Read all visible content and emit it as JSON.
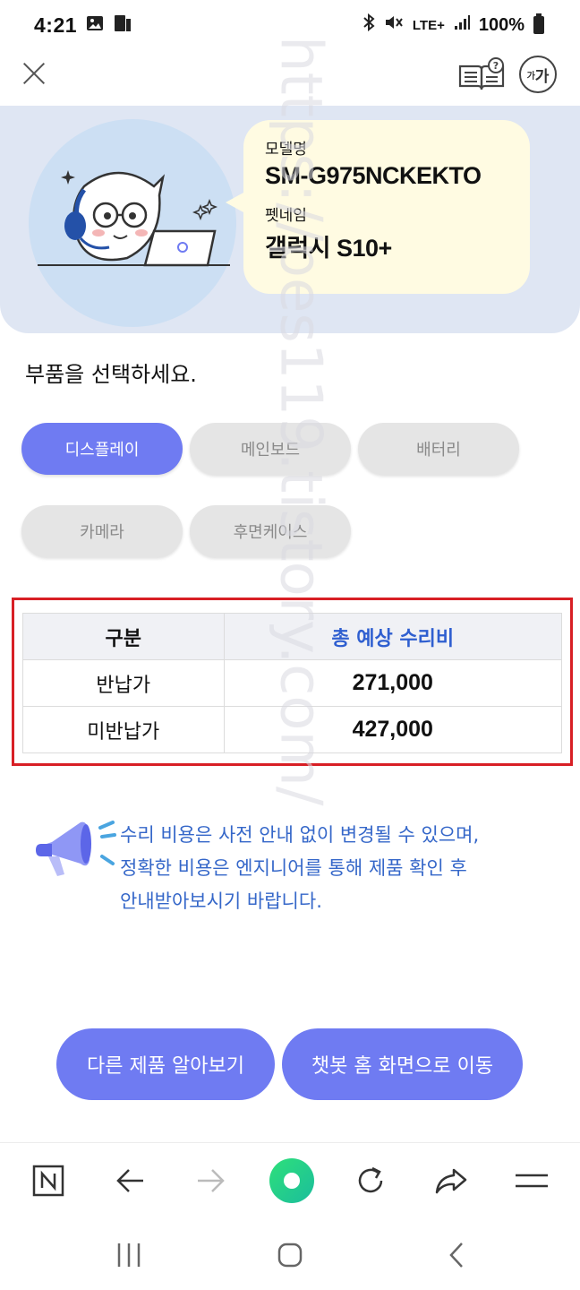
{
  "status_bar": {
    "time": "4:21",
    "network": "LTE+",
    "battery": "100%",
    "icons": [
      "gallery-icon",
      "sim-icon",
      "bluetooth-icon",
      "mute-icon",
      "signal-icon",
      "battery-icon"
    ]
  },
  "toolbar": {
    "close_icon": "close-icon",
    "guide_icon": "book-help-icon",
    "font_size_icon": "font-size-icon",
    "font_size_label_small": "가",
    "font_size_label_large": "가"
  },
  "device": {
    "model_label": "모델명",
    "model_value": "SM-G975NCKEKTO",
    "pet_name_label": "펫네임",
    "pet_name_value": "갤럭시 S10+"
  },
  "prompt": "부품을 선택하세요.",
  "parts": [
    {
      "label": "디스플레이",
      "selected": true
    },
    {
      "label": "메인보드",
      "selected": false
    },
    {
      "label": "배터리",
      "selected": false
    },
    {
      "label": "카메라",
      "selected": false
    },
    {
      "label": "후면케이스",
      "selected": false
    }
  ],
  "cost_table": {
    "header_type": "구분",
    "header_cost": "총 예상 수리비",
    "rows": [
      {
        "type": "반납가",
        "cost": "271,000"
      },
      {
        "type": "미반납가",
        "cost": "427,000"
      }
    ]
  },
  "notice": {
    "line1": "수리 비용은 사전 안내 없이 변경될 수 있으며,",
    "line2": "정확한 비용은 엔지니어를 통해 제품 확인 후",
    "line3": "안내받아보시기 바랍니다."
  },
  "actions": {
    "other_product": "다른 제품 알아보기",
    "chatbot_home": "챗봇 홈 화면으로 이동"
  },
  "watermark": "https://pes119.tistory.com/",
  "colors": {
    "accent": "#6f7bf2",
    "highlight_border": "#d81f25",
    "notice_text": "#3567c9",
    "header_blue": "#2f5fd0"
  }
}
